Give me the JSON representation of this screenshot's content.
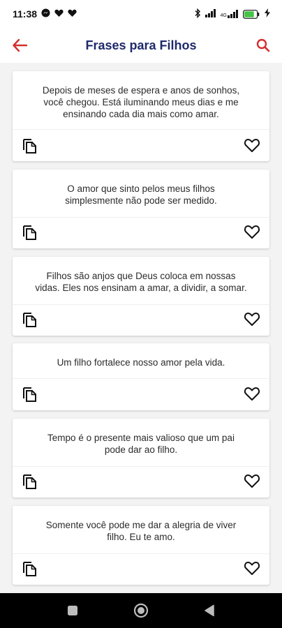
{
  "status_bar": {
    "time": "11:38",
    "network_label": "4G",
    "battery_level": "80"
  },
  "app_bar": {
    "title": "Frases para Filhos",
    "back_icon": "arrow-left-icon",
    "search_icon": "search-icon"
  },
  "colors": {
    "accent_red": "#d32f2f",
    "title_navy": "#1f2a6b"
  },
  "quotes": [
    {
      "lines": [
        "Depois de meses de espera e anos de sonhos,",
        "você chegou. Está iluminando meus dias e me",
        "ensinando cada dia mais como amar."
      ]
    },
    {
      "lines": [
        "O amor que sinto pelos meus filhos",
        "simplesmente não pode ser medido."
      ]
    },
    {
      "lines": [
        "Filhos são anjos que Deus coloca em nossas",
        "vidas. Eles nos ensinam a amar, a dividir, a somar."
      ]
    },
    {
      "lines": [
        "Um filho fortalece nosso amor pela vida."
      ]
    },
    {
      "lines": [
        "Tempo é o presente mais valioso que um pai",
        "pode dar ao filho."
      ]
    },
    {
      "lines": [
        "Somente você pode me dar a alegria de viver",
        "filho. Eu te amo."
      ]
    }
  ],
  "card_icons": {
    "copy": "copy-icon",
    "favorite": "heart-outline-icon"
  },
  "nav": [
    "square-recents-icon",
    "circle-home-icon",
    "triangle-back-icon"
  ]
}
